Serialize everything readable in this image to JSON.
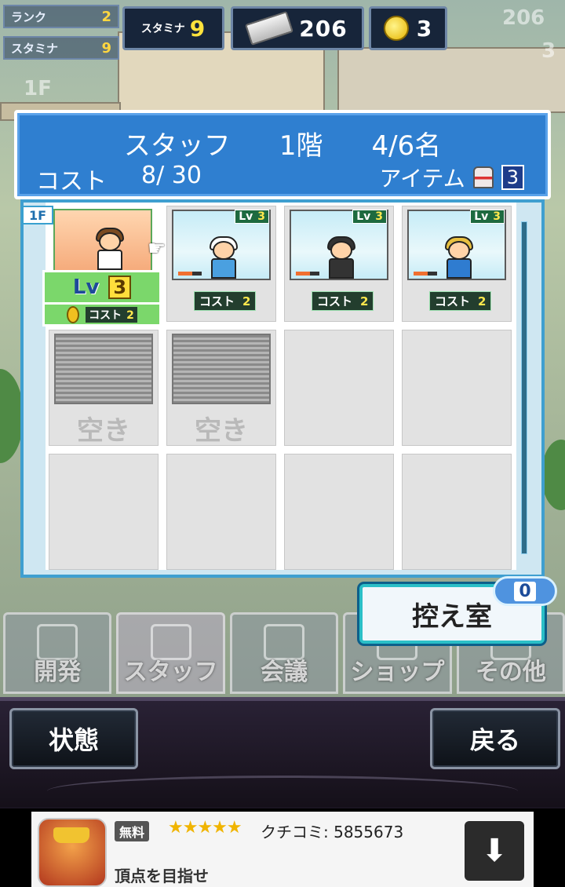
{
  "side_stats": [
    {
      "label": "ランク",
      "value": "2"
    },
    {
      "label": "スタミナ",
      "value": "9"
    }
  ],
  "top_bar": {
    "stamina_label": "スタミナ",
    "stamina": "9",
    "tickets": "206",
    "coins": "3",
    "ghost_tickets": "206",
    "ghost_coins": "3"
  },
  "floor_sign": "1F",
  "dialog": {
    "title": "スタッフ",
    "floor": "1階",
    "count": "4/6名",
    "cost_label": "コスト",
    "cost_value": "8/ 30",
    "item_label": "アイテム",
    "item_count": "3",
    "floor_tag": "1F"
  },
  "selected_staff": {
    "lv_label": "Lv",
    "level": "3",
    "cost_label": "コスト",
    "cost": "2"
  },
  "staff": [
    {
      "lv_label": "Lv",
      "level": "3",
      "cost_label": "コスト",
      "cost": "2",
      "hair": "#ffffff",
      "shirt": "#4aa0e0"
    },
    {
      "lv_label": "Lv",
      "level": "3",
      "cost_label": "コスト",
      "cost": "2",
      "hair": "#333333",
      "shirt": "#333333"
    },
    {
      "lv_label": "Lv",
      "level": "3",
      "cost_label": "コスト",
      "cost": "2",
      "hair": "#e8c040",
      "shirt": "#2f7cd0"
    }
  ],
  "empty_label": "空き",
  "reserve": {
    "label": "控え室",
    "count": "0"
  },
  "tabs": [
    "開発",
    "スタッフ",
    "会議",
    "ショップ",
    "その他"
  ],
  "buttons": {
    "status": "状態",
    "back": "戻る"
  },
  "ad": {
    "free": "無料",
    "stars": "★★★★★",
    "reviews": "クチコミ: 5855673",
    "subtitle": "頂点を目指せ"
  }
}
